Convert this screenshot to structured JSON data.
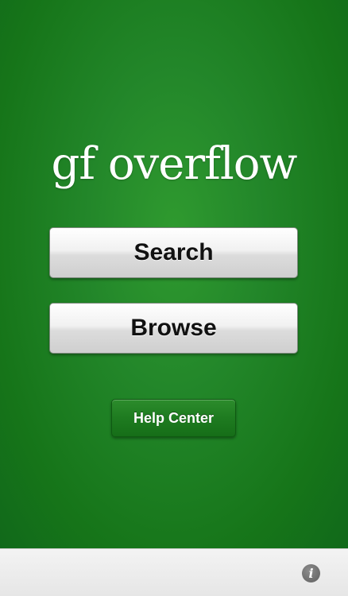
{
  "app": {
    "logo_text": "gf overflow"
  },
  "main": {
    "search_label": "Search",
    "browse_label": "Browse",
    "help_label": "Help Center"
  },
  "bottom_bar": {
    "info_icon": "info-icon",
    "info_glyph": "i"
  },
  "colors": {
    "background_green": "#23872a",
    "button_face": "#e8e8e8",
    "help_button_green": "#1e7b20",
    "bottom_bar": "#ececec"
  }
}
